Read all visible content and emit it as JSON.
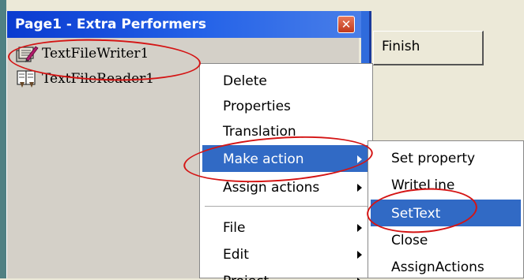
{
  "window": {
    "title": "Page1 - Extra Performers",
    "close_glyph": "✕"
  },
  "performers": [
    {
      "label": "TextFileWriter1",
      "icon": "text-file-writer-icon"
    },
    {
      "label": "TextFileReader1",
      "icon": "text-file-reader-icon"
    }
  ],
  "finish_button": "Finish",
  "context_menu": {
    "items": [
      {
        "label": "Delete"
      },
      {
        "label": "Properties"
      },
      {
        "label": "Translation"
      },
      {
        "label": "Make action",
        "selected": true,
        "submenu": true
      },
      {
        "label": "Assign actions",
        "submenu": true
      },
      {
        "label": "File",
        "submenu": true
      },
      {
        "label": "Edit",
        "submenu": true
      },
      {
        "label": "Project",
        "submenu": true
      }
    ]
  },
  "submenu": {
    "items": [
      {
        "label": "Set property"
      },
      {
        "label": "WriteLine"
      },
      {
        "label": "SetText",
        "selected": true
      },
      {
        "label": "Close"
      },
      {
        "label": "AssignActions"
      }
    ]
  },
  "colors": {
    "title_bar": "#0a3bd0",
    "selection": "#316ac5",
    "annotation": "#d41414",
    "desktop": "#4f8083"
  }
}
